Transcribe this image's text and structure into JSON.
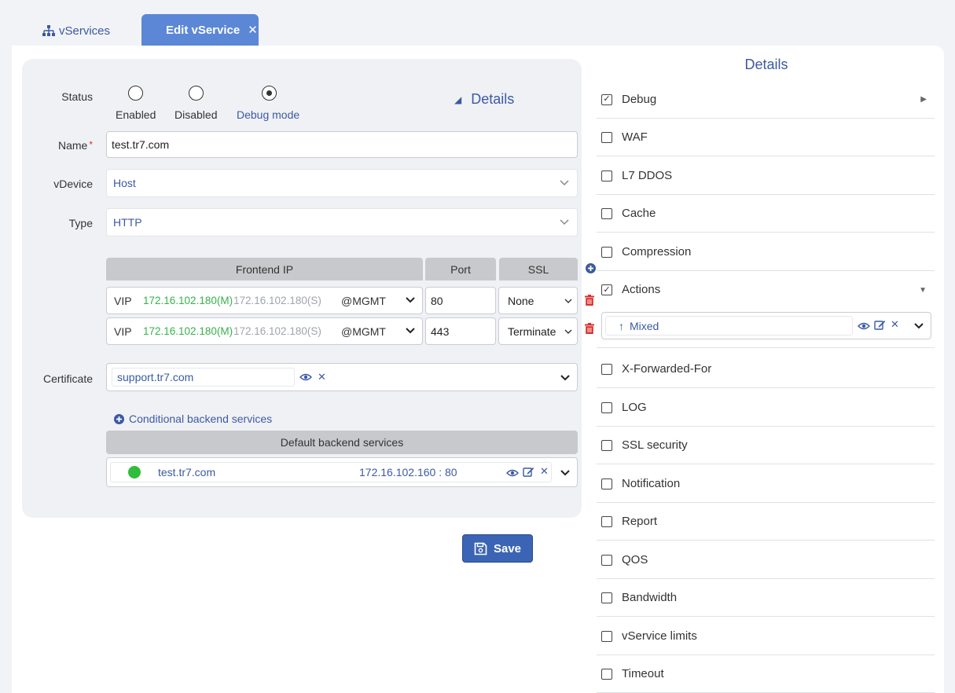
{
  "tabs": {
    "vservices_label": "vServices",
    "edit_label": "Edit vService",
    "close_glyph": "✕"
  },
  "status": {
    "label": "Status",
    "options": [
      "Enabled",
      "Disabled",
      "Debug mode"
    ],
    "selected": "Debug mode"
  },
  "details_toggle": "Details",
  "name": {
    "label": "Name",
    "required_mark": "*",
    "value": "test.tr7.com"
  },
  "vdevice": {
    "label": "vDevice",
    "value": "Host"
  },
  "type": {
    "label": "Type",
    "value": "HTTP"
  },
  "frontend": {
    "headers": {
      "ip": "Frontend IP",
      "port": "Port",
      "ssl": "SSL"
    },
    "rows": [
      {
        "vip": "VIP",
        "master": "172.16.102.180(M)",
        "slave": "172.16.102.180(S)",
        "iface": "@MGMT",
        "port": "80",
        "ssl": "None"
      },
      {
        "vip": "VIP",
        "master": "172.16.102.180(M)",
        "slave": "172.16.102.180(S)",
        "iface": "@MGMT",
        "port": "443",
        "ssl": "Terminate"
      }
    ]
  },
  "certificate": {
    "label": "Certificate",
    "value": "support.tr7.com"
  },
  "conditional_link": "Conditional backend services",
  "backend": {
    "header": "Default backend services",
    "rows": [
      {
        "name": "test.tr7.com",
        "address": "172.16.102.160 : 80",
        "status_color": "#2fbe3c"
      }
    ]
  },
  "save_label": "Save",
  "details_panel": {
    "title": "Details",
    "items": [
      {
        "label": "Debug",
        "checked": true,
        "arrow": "right"
      },
      {
        "label": "WAF",
        "checked": false
      },
      {
        "label": "L7 DDOS",
        "checked": false
      },
      {
        "label": "Cache",
        "checked": false
      },
      {
        "label": "Compression",
        "checked": false
      },
      {
        "label": "Actions",
        "checked": true,
        "arrow": "down"
      },
      {
        "label": "X-Forwarded-For",
        "checked": false
      },
      {
        "label": "LOG",
        "checked": false
      },
      {
        "label": "SSL security",
        "checked": false
      },
      {
        "label": "Notification",
        "checked": false
      },
      {
        "label": "Report",
        "checked": false
      },
      {
        "label": "QOS",
        "checked": false
      },
      {
        "label": "Bandwidth",
        "checked": false
      },
      {
        "label": "vService limits",
        "checked": false
      },
      {
        "label": "Timeout",
        "checked": false
      }
    ],
    "actions_value": "Mixed"
  },
  "colors": {
    "accent": "#3b5aa3",
    "tab_active": "#5b87d6",
    "save_bg": "#3b65b4",
    "delete": "#d9302c",
    "master_ip": "#38b24a"
  }
}
